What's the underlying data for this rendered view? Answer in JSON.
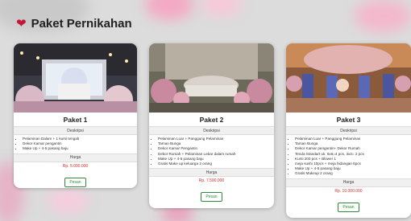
{
  "header": {
    "title": "Paket Pernikahan",
    "icon": "heart-icon",
    "accent": "#c2183a"
  },
  "labels": {
    "description": "Deskripsi",
    "price": "Harga",
    "button": "Pesan"
  },
  "packages": [
    {
      "name": "Paket 1",
      "items": [
        "Pelaminan Dalam + 1 kursi tengah",
        "Dekor Kamar pengantin",
        "Make Up + 4-5 pasang baju"
      ],
      "price": "Rp. 5.000.000"
    },
    {
      "name": "Paket 2",
      "items": [
        "Pelaminan Luar + Panggung Pelaminan",
        "Taman Bunga",
        "Dekor Kamar Pengantin",
        "Dekor Rumah + Pelaminan Lebar dalam rumah",
        "Make Up + 4-5 pasang baju",
        "Gratis Make up keluarga 2 orang"
      ],
      "price": "Rp. 7.500.000"
    },
    {
      "name": "Paket 3",
      "items": [
        "Pelaminan Luar + Panggung Pelaminan",
        "Taman Bunga",
        "Dekor Kamar pengantin+ Dekor Rumah",
        "Tenda Standart uk. 6x6=4 pcs, 3x3= 2 pcs",
        "Kursi 200 pcs + Blower 1",
        "meja sushi 10pcs + meja hidangan 6pcs",
        "Make Up + 4-5 pasang baju",
        "Gratis Makeup 2 orang"
      ],
      "price": "Rp. 10.000.000"
    }
  ]
}
